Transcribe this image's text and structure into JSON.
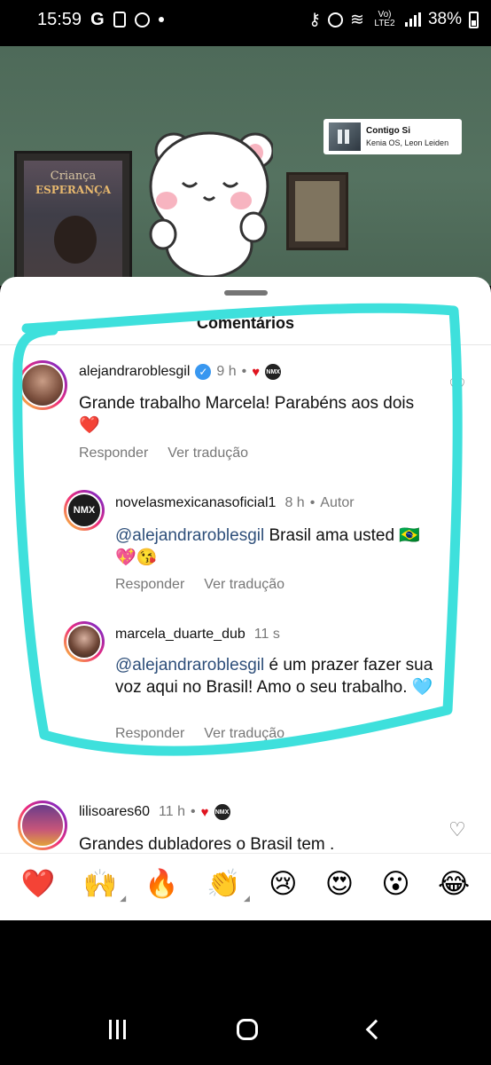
{
  "status_bar": {
    "time": "15:59",
    "carrier_icon": "G",
    "signal_label": "Vo) LTE2",
    "battery": "38%"
  },
  "video": {
    "music": {
      "title": "Contigo Si",
      "artist": "Kenia OS, Leon Leiden"
    },
    "poster_text_1": "Criança",
    "poster_text_2": "ESPERANÇA"
  },
  "comments_sheet": {
    "title": "Comentários",
    "comments": [
      {
        "username": "alejandraroblesgil",
        "time": "9 h",
        "text": "Grande trabalho Marcela! Parabéns aos dois ❤️",
        "reply_label": "Responder",
        "translate_label": "Ver tradução"
      },
      {
        "username": "novelasmexicanasoficial1",
        "time": "8 h",
        "author_tag": "Autor",
        "avatar_text": "NMX",
        "mention": "@alejandraroblesgil",
        "text": " Brasil ama usted 🇧🇷💖😘",
        "reply_label": "Responder",
        "translate_label": "Ver tradução"
      },
      {
        "username": "marcela_duarte_dub",
        "time": "11 s",
        "mention": "@alejandraroblesgil",
        "text": " é um prazer fazer sua voz aqui no Brasil! Amo o seu trabalho. 🩵",
        "reply_label": "Responder",
        "translate_label": "Ver tradução"
      },
      {
        "username": "lilisoares60",
        "time": "11 h",
        "text": "Grandes dubladores o Brasil tem ."
      }
    ]
  },
  "emoji_bar": [
    "❤️",
    "🙌",
    "🔥",
    "👏",
    "😢",
    "😍",
    "😮",
    "😂"
  ],
  "colors": {
    "highlight": "#3ee0dc",
    "mention": "#2e4f7a",
    "like_heart": "#e0141f",
    "verified": "#3897f0"
  },
  "icons": [
    "wifi-icon",
    "alarm-icon",
    "key-icon",
    "verified-badge-icon",
    "heart-icon",
    "nav-recents-icon",
    "nav-home-icon",
    "nav-back-icon"
  ]
}
